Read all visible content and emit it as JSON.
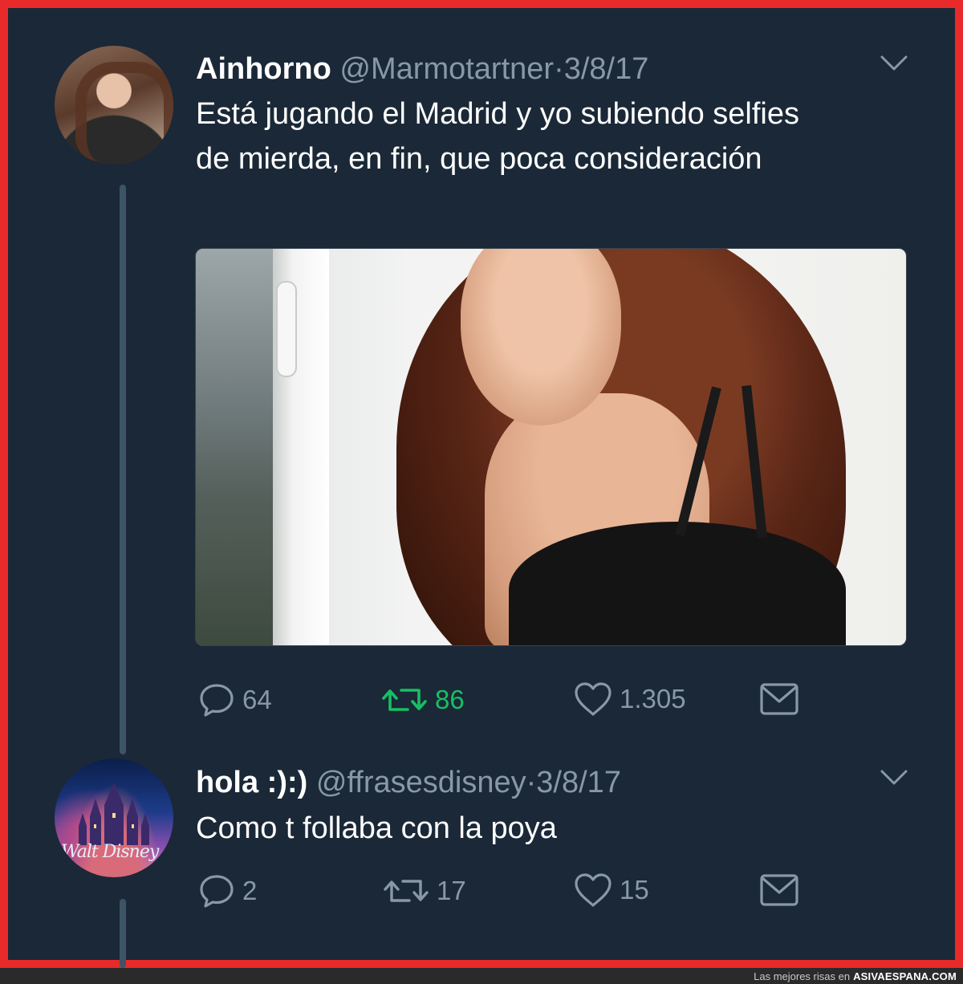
{
  "tweets": [
    {
      "name": "Ainhorno",
      "handle": "@Marmotartner",
      "separator": "·",
      "date": "3/8/17",
      "text": "Está jugando el Madrid y yo subiendo selfies de mierda, en fin, que poca consideración",
      "avatar_icon": "profile-photo",
      "has_media": true,
      "actions": {
        "replies": "64",
        "retweets": "86",
        "likes": "1.305",
        "retweet_active": true
      }
    },
    {
      "name": "hola :):)",
      "handle": "@ffrasesdisney",
      "separator": "·",
      "date": "3/8/17",
      "text": "Como t follaba con la poya",
      "avatar_icon": "disney-castle-logo",
      "avatar_logo_text": "WALT DISNEY",
      "has_media": false,
      "actions": {
        "replies": "2",
        "retweets": "17",
        "likes": "15",
        "retweet_active": false
      }
    }
  ],
  "footer": {
    "prefix": "Las mejores risas en",
    "brand": "ASIVAESPANA.COM"
  },
  "colors": {
    "background": "#1b2837",
    "frame_border": "#e82a2a",
    "muted_text": "#8899a6",
    "retweet_active": "#17bf63",
    "thread_line": "#3d5466"
  }
}
